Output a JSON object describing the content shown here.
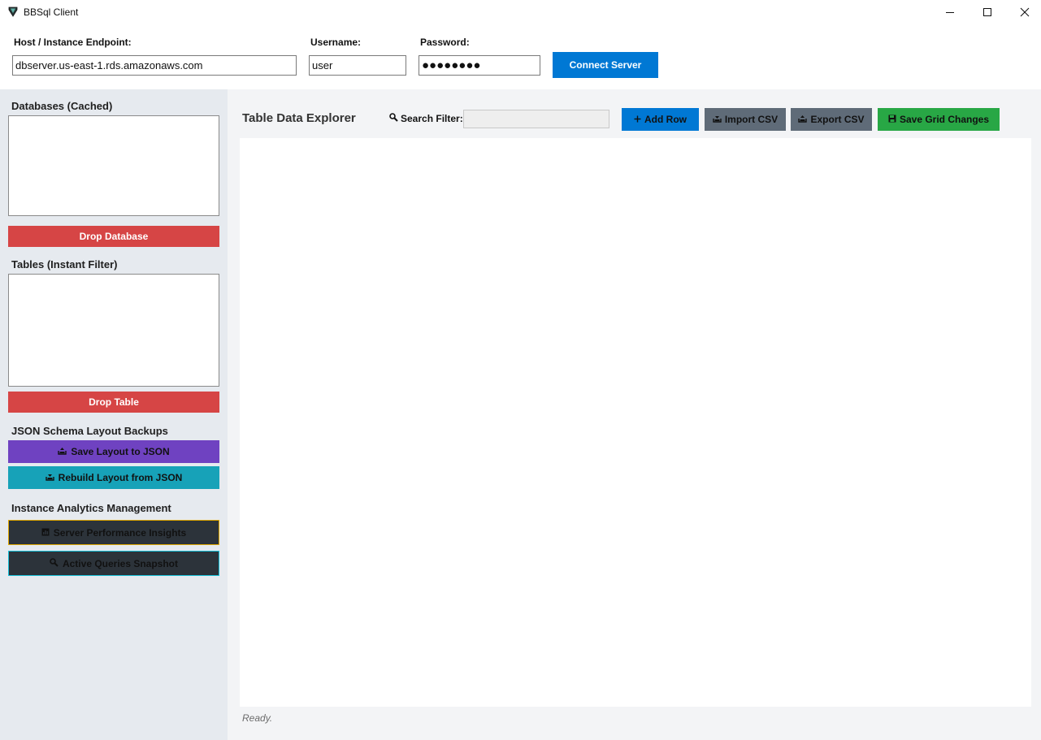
{
  "window": {
    "title": "BBSql Client",
    "app_icon": "shield-icon",
    "controls": [
      "minimize-icon",
      "maximize-icon",
      "close-icon"
    ]
  },
  "connection": {
    "host_label": "Host / Instance Endpoint:",
    "host_value": "dbserver.us-east-1.rds.amazonaws.com",
    "username_label": "Username:",
    "username_value": "user",
    "password_label": "Password:",
    "password_masked": "●●●●●●●●",
    "connect_label": "Connect Server"
  },
  "sidebar": {
    "databases_title": "Databases (Cached)",
    "databases": [],
    "drop_database_label": "Drop Database",
    "tables_title": "Tables (Instant Filter)",
    "tables": [],
    "drop_table_label": "Drop Table",
    "json_section_title": "JSON Schema Layout Backups",
    "save_layout_label": "Save Layout to JSON",
    "rebuild_layout_label": "Rebuild Layout from JSON",
    "analytics_section_title": "Instance Analytics Management",
    "server_insights_label": "Server Performance Insights",
    "active_queries_label": "Active Queries Snapshot"
  },
  "main": {
    "title": "Table Data Explorer",
    "search_label": "Search Filter:",
    "search_value": "",
    "add_row_label": "Add Row",
    "import_csv_label": "Import CSV",
    "export_csv_label": "Export CSV",
    "save_grid_label": "Save Grid Changes",
    "status_text": "Ready."
  },
  "colors": {
    "accent_blue": "#0078d4",
    "danger_red": "#d64545",
    "purple": "#6f42c1",
    "teal": "#17a2b8",
    "gray": "#5f6b78",
    "green": "#28a745",
    "dark": "#2c333a"
  }
}
